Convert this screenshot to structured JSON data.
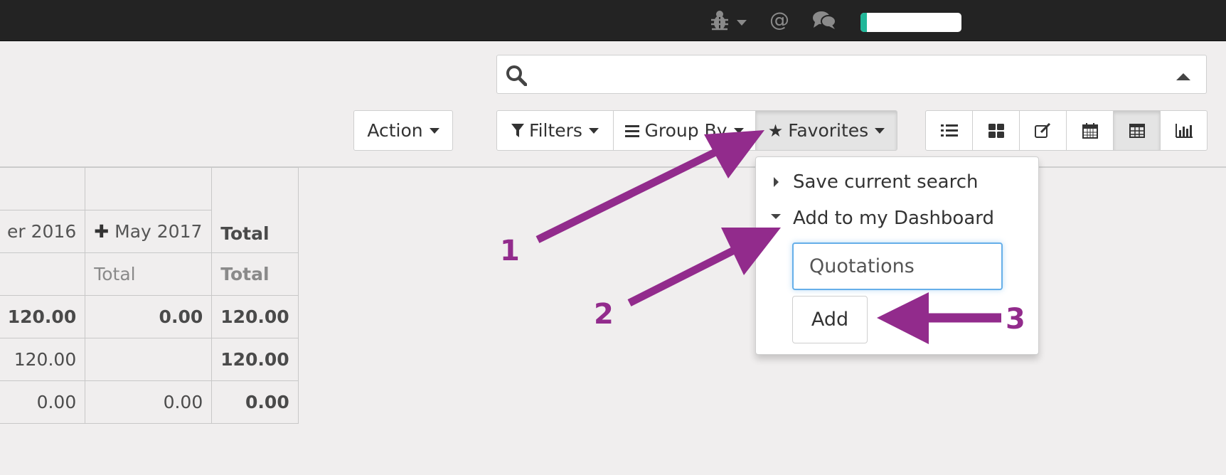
{
  "topbar": {
    "icons": [
      "bug-icon",
      "at-icon",
      "chat-icon"
    ],
    "progress": 0.06,
    "accent": "#21b799"
  },
  "search": {
    "value": "",
    "placeholder": ""
  },
  "toolbar": {
    "action_label": "Action",
    "filters_label": "Filters",
    "groupby_label": "Group By",
    "favorites_label": "Favorites",
    "views": [
      "list-view",
      "kanban-view",
      "form-view",
      "calendar-view",
      "pivot-view",
      "graph-view"
    ],
    "active_view": "pivot-view"
  },
  "pivot": {
    "col_headers": [
      "er 2016",
      "May 2017",
      "Total"
    ],
    "measure_headers": [
      "",
      "Total",
      "Total"
    ],
    "rows": [
      [
        "120.00",
        "0.00",
        "120.00"
      ],
      [
        "120.00",
        "",
        "120.00"
      ],
      [
        "0.00",
        "0.00",
        "0.00"
      ]
    ]
  },
  "favorites_menu": {
    "save_current_search": "Save current search",
    "add_to_dashboard": "Add to my Dashboard",
    "dashboard_name_value": "Quotations",
    "add_button": "Add"
  },
  "annotations": {
    "color": "#922b8c",
    "labels": [
      "1",
      "2",
      "3"
    ]
  }
}
